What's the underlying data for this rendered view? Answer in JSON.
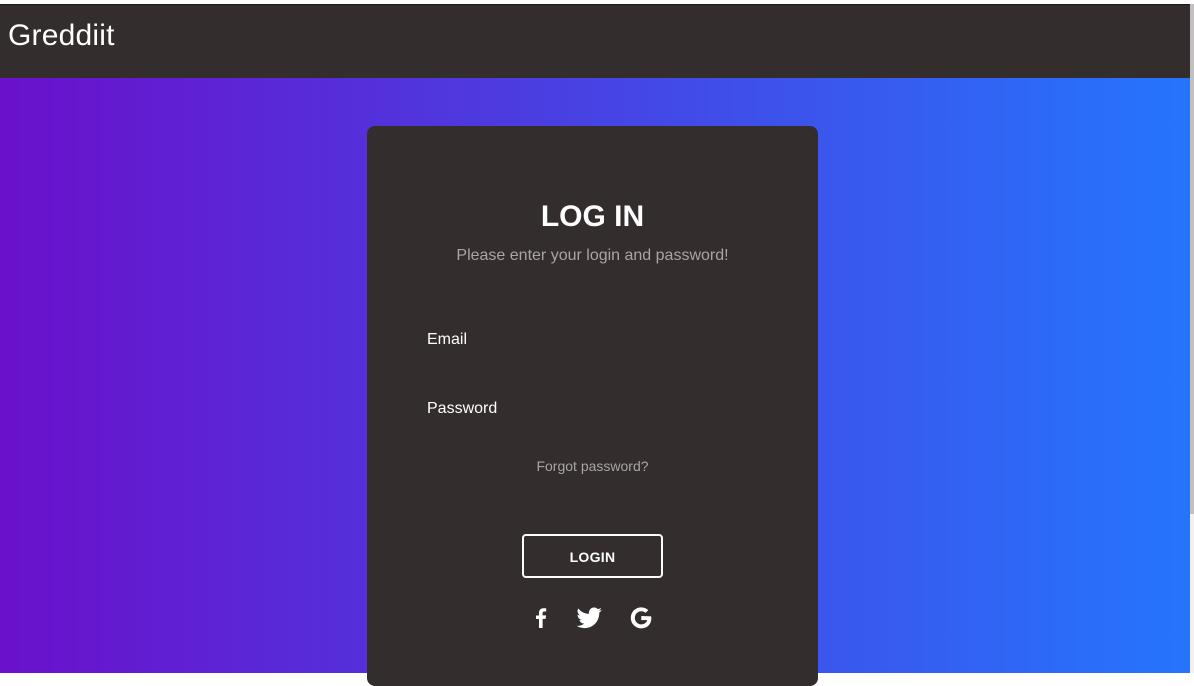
{
  "navbar": {
    "brand": "Greddiit"
  },
  "login_card": {
    "title": "LOG IN",
    "subtitle": "Please enter your login and password!",
    "email_label": "Email",
    "password_label": "Password",
    "forgot_password": "Forgot password?",
    "login_button": "LOGIN",
    "social_icons": [
      "facebook-icon",
      "twitter-icon",
      "google-icon"
    ]
  },
  "colors": {
    "navbar_bg": "#332d2d",
    "card_bg": "#332d2d",
    "gradient_start": "#6a11cb",
    "gradient_end": "#2575fc",
    "text_primary": "#ffffff",
    "text_muted": "#a9a5a5"
  }
}
